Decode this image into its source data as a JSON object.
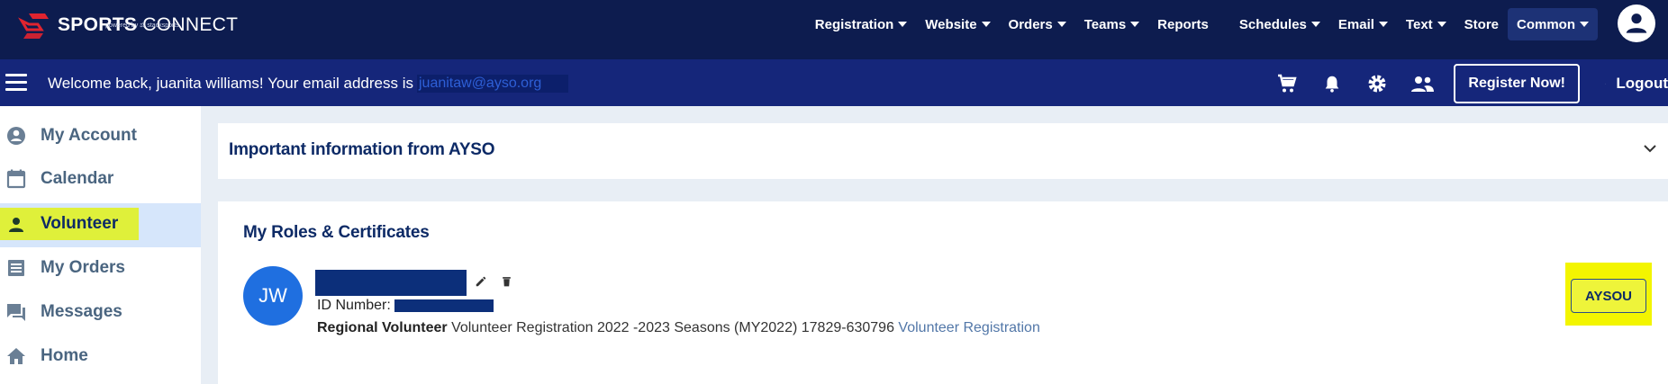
{
  "brand": {
    "name_bold": "SPORTS",
    "name_thin": "CONNECT",
    "powered_by": "powered by ⚖ stacksports"
  },
  "topnav": {
    "items": [
      {
        "label": "Registration",
        "dropdown": true
      },
      {
        "label": "Website",
        "dropdown": true
      },
      {
        "label": "Orders",
        "dropdown": true
      },
      {
        "label": "Teams",
        "dropdown": true
      },
      {
        "label": "Reports",
        "dropdown": false
      },
      {
        "label": "Schedules",
        "dropdown": true
      },
      {
        "label": "Email",
        "dropdown": true
      },
      {
        "label": "Text",
        "dropdown": true
      },
      {
        "label": "Store",
        "dropdown": false
      },
      {
        "label": "Common",
        "dropdown": true,
        "active": true
      }
    ],
    "account_icon": "user-circle-icon"
  },
  "subbar": {
    "welcome_text": "Welcome back, juanita williams! Your email address is",
    "email": "juanitaw@ayso.org",
    "icons": [
      "cart-icon",
      "bell-icon",
      "gear-icon",
      "people-icon"
    ],
    "register_label": "Register Now!",
    "logout_label": "Logout"
  },
  "sidebar": {
    "items": [
      {
        "label": "My Account",
        "icon": "account-circle-icon"
      },
      {
        "label": "Calendar",
        "icon": "calendar-icon"
      },
      {
        "label": "Volunteer",
        "icon": "person-icon",
        "active": true
      },
      {
        "label": "My Orders",
        "icon": "list-icon"
      },
      {
        "label": "Messages",
        "icon": "chat-icon"
      },
      {
        "label": "Home",
        "icon": "home-icon"
      }
    ]
  },
  "info_panel": {
    "title": "Important information from AYSO"
  },
  "roles": {
    "title": "My Roles & Certificates",
    "avatar_initials": "JW",
    "id_label": "ID Number:",
    "role_bold": "Regional Volunteer",
    "registration_text": "Volunteer Registration 2022 -2023 Seasons (MY2022) 17829-630796",
    "registration_link": "Volunteer Registration",
    "aysou_label": "AYSOU"
  },
  "colors": {
    "top_nav": "#0d1c4f",
    "sub_nav": "#15267a",
    "highlight": "#dff03a",
    "avatar_blue": "#1f6fe0"
  }
}
